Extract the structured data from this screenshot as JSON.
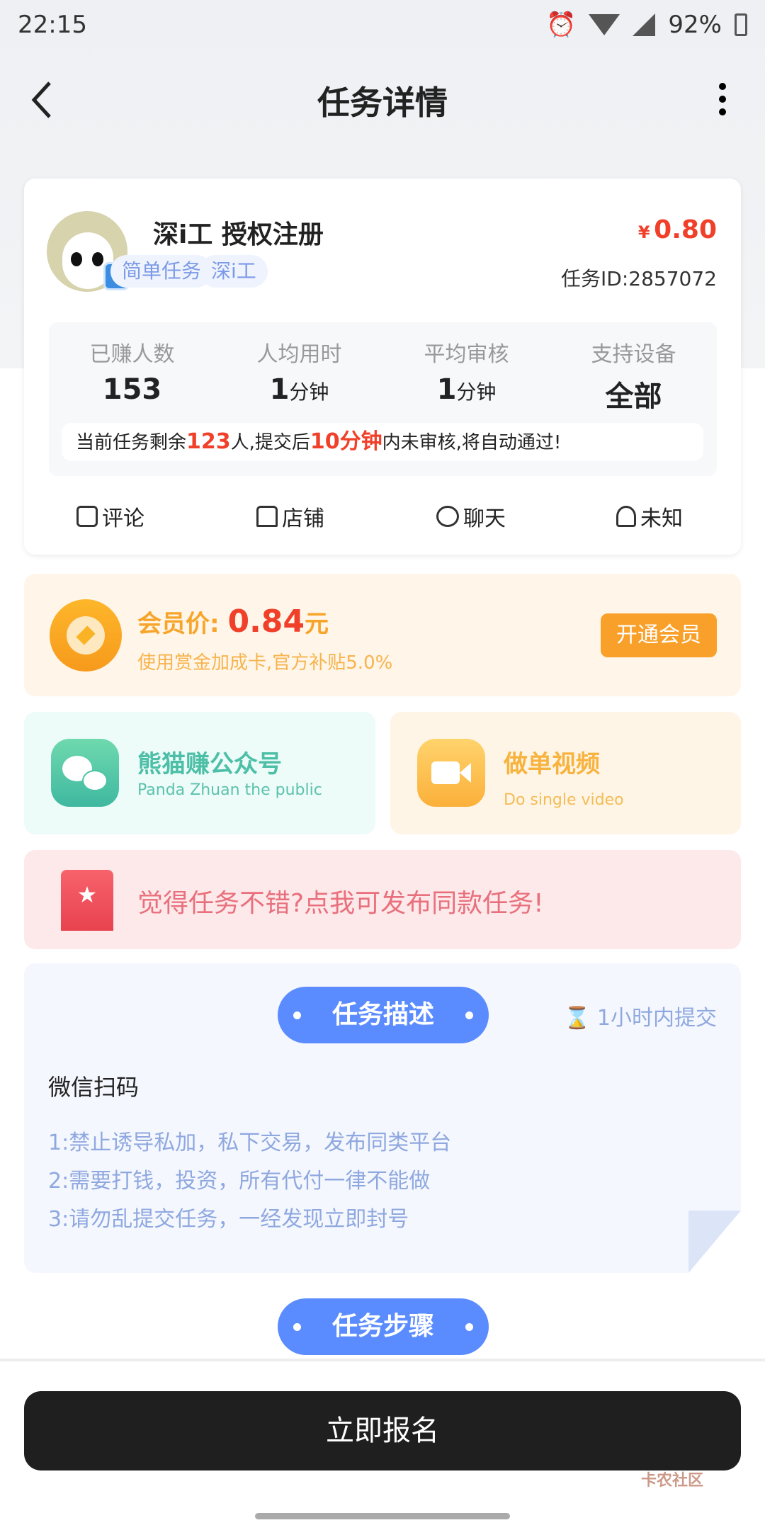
{
  "status_bar": {
    "time": "22:15",
    "battery": "92%"
  },
  "header": {
    "title": "任务详情"
  },
  "task": {
    "title": "深i工 授权注册",
    "tags": [
      "简单任务",
      "深i工"
    ],
    "currency": "¥",
    "price": "0.80",
    "task_id": "任务ID:2857072"
  },
  "stats": [
    {
      "label": "已赚人数",
      "value": "153",
      "unit": ""
    },
    {
      "label": "人均用时",
      "value": "1",
      "unit": "分钟"
    },
    {
      "label": "平均审核",
      "value": "1",
      "unit": "分钟"
    },
    {
      "label": "支持设备",
      "value": "全部",
      "unit": ""
    }
  ],
  "notice": {
    "p1": "当前任务剩余",
    "n1": "123",
    "p2": "人,提交后",
    "n2": "10分钟",
    "p3": "内未审核,将自动通过!"
  },
  "actions": [
    {
      "label": "评论",
      "icon": "comment-icon"
    },
    {
      "label": "店铺",
      "icon": "shop-icon"
    },
    {
      "label": "聊天",
      "icon": "chat-icon"
    },
    {
      "label": "未知",
      "icon": "location-icon"
    }
  ],
  "member": {
    "label": "会员价:",
    "price": "0.84",
    "unit": "元",
    "sub": "使用赏金加成卡,官方补贴5.0%",
    "button": "开通会员"
  },
  "promo_left": {
    "title": "熊猫赚公众号",
    "sub": "Panda Zhuan the public"
  },
  "promo_right": {
    "title": "做单视频",
    "sub": "Do single video"
  },
  "publish_banner": {
    "text": "觉得任务不错?点我可发布同款任务!"
  },
  "description": {
    "pill": "任务描述",
    "deadline": "1小时内提交",
    "main": "微信扫码",
    "rules": [
      "1:禁止诱导私加，私下交易，发布同类平台",
      "2:需要打钱，投资，所有代付一律不能做",
      "3:请勿乱提交任务，一经发现立即封号"
    ]
  },
  "steps": {
    "pill": "任务步骤"
  },
  "footer": {
    "button": "立即报名",
    "watermark": "卡农社区"
  },
  "colors": {
    "accent": "#5b8cff",
    "price_red": "#f0402a",
    "member_orange": "#f7a52a"
  }
}
